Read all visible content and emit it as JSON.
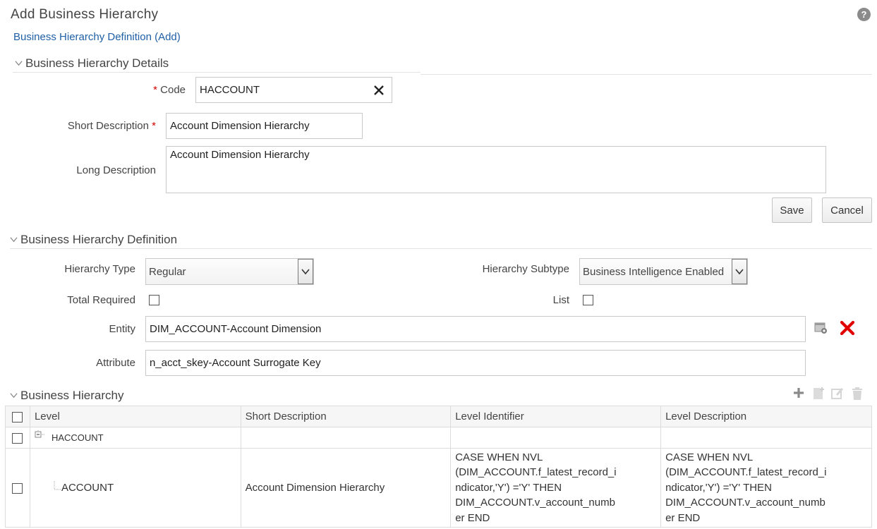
{
  "page": {
    "title": "Add Business Hierarchy",
    "help_icon": "?",
    "breadcrumb": "Business Hierarchy Definition (Add)"
  },
  "details": {
    "header": "Business Hierarchy Details",
    "code_label": "Code",
    "code_value": "HACCOUNT",
    "short_desc_label": "Short Description",
    "short_desc_value": "Account Dimension Hierarchy",
    "long_desc_label": "Long Description",
    "long_desc_value": "Account Dimension Hierarchy",
    "required_mark": "*",
    "save_label": "Save",
    "cancel_label": "Cancel"
  },
  "definition": {
    "header": "Business Hierarchy Definition",
    "hierarchy_type_label": "Hierarchy Type",
    "hierarchy_type_value": "Regular",
    "hierarchy_subtype_label": "Hierarchy Subtype",
    "hierarchy_subtype_value": "Business Intelligence Enabled",
    "total_required_label": "Total Required",
    "list_label": "List",
    "entity_label": "Entity",
    "entity_value": "DIM_ACCOUNT-Account Dimension",
    "attribute_label": "Attribute",
    "attribute_value": "n_acct_skey-Account Surrogate Key"
  },
  "hierarchy": {
    "header": "Business Hierarchy",
    "columns": [
      "Level",
      "Short Description",
      "Level Identifier",
      "Level Description"
    ],
    "rows": [
      {
        "level": "HACCOUNT",
        "short_description": "",
        "level_identifier": "",
        "level_description": ""
      },
      {
        "level": "ACCOUNT",
        "short_description": "Account Dimension Hierarchy",
        "level_identifier": "   CASE WHEN NVL\n(DIM_ACCOUNT.f_latest_record_i\nndicator,'Y') ='Y' THEN\nDIM_ACCOUNT.v_account_numb\ner END",
        "level_description": "   CASE WHEN NVL\n(DIM_ACCOUNT.f_latest_record_i\nndicator,'Y') ='Y' THEN\nDIM_ACCOUNT.v_account_numb\ner END"
      }
    ]
  },
  "icons": {
    "chevron": "chevron-down-icon",
    "clear": "close-icon",
    "entity_browse": "hierarchy-browse-icon",
    "entity_remove": "delete-x-icon",
    "add": "plus-icon",
    "add_child": "add-document-icon",
    "edit": "edit-icon",
    "delete": "trash-icon",
    "collapse": "minus-box-icon"
  },
  "colors": {
    "link": "#1f5fa6",
    "required": "#d00000",
    "remove_icon": "#e00000"
  }
}
